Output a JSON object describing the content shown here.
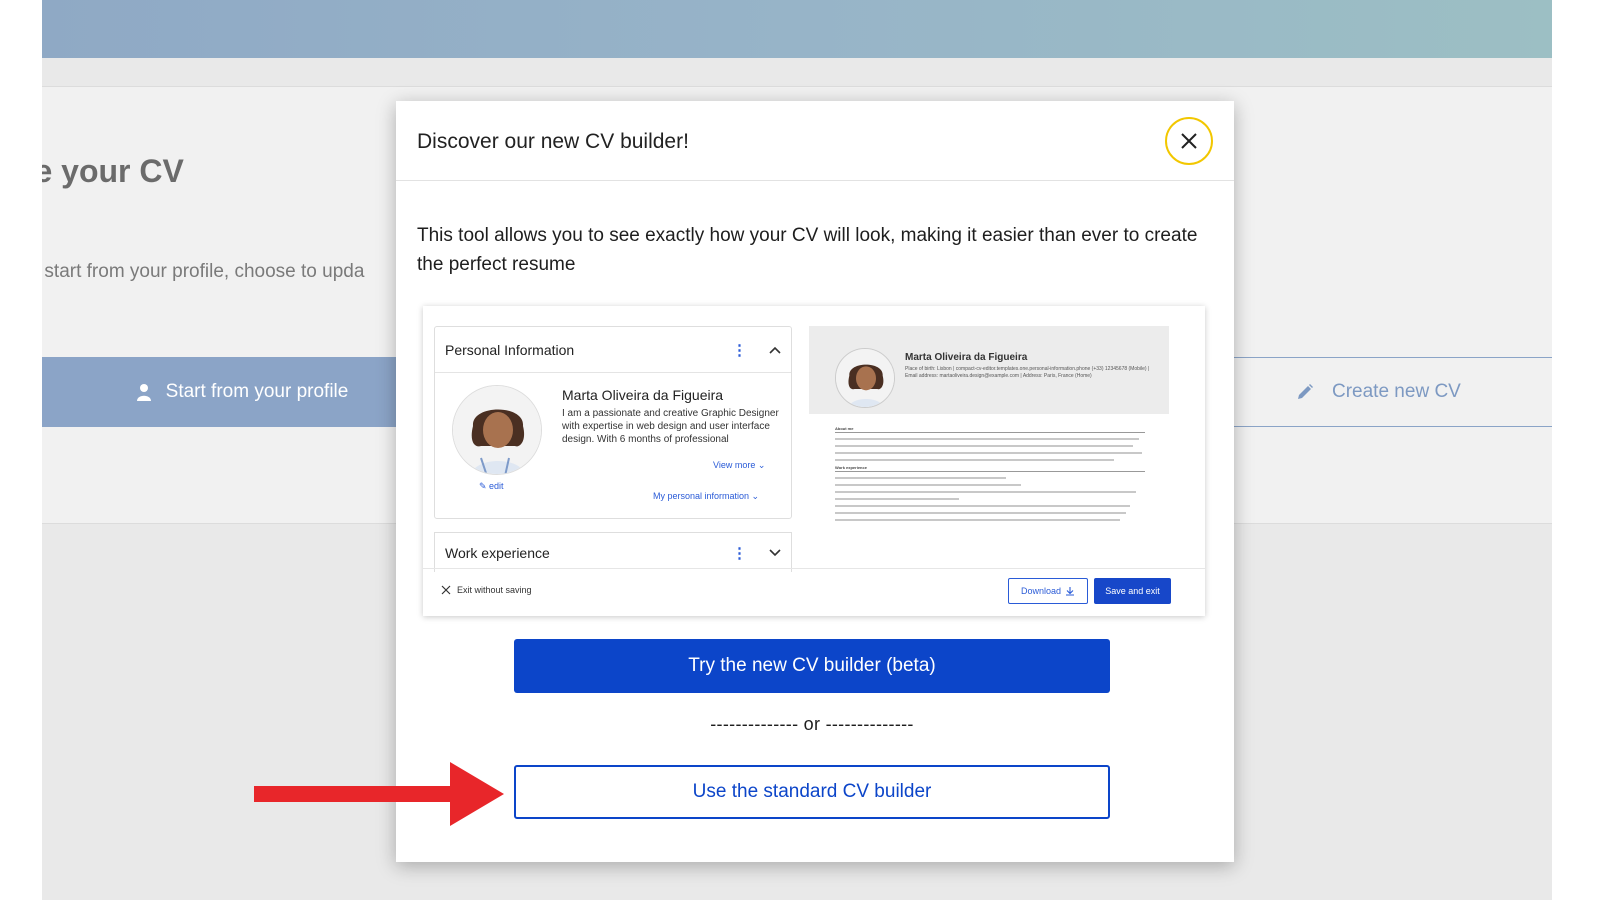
{
  "background_page": {
    "title": "ate your CV",
    "subtitle": "an start from your profile, choose to upda",
    "option_profile_label": "Start from your profile",
    "option_new_label": "Create new CV"
  },
  "modal": {
    "title": "Discover our new CV builder!",
    "description": "This tool allows you to see exactly how your CV will look, making it easier than ever to create the perfect resume",
    "primary_button": "Try the new CV builder (beta)",
    "separator": "-------------- or --------------",
    "secondary_button": "Use the standard CV builder"
  },
  "preview": {
    "personal_info_heading": "Personal Information",
    "person_name": "Marta Oliveira da Figueira",
    "bio": "I am a passionate and creative Graphic Designer with expertise in web design and user interface design. With 6 months of professional",
    "view_more": "View more",
    "edit": "edit",
    "my_personal_information": "My personal information",
    "work_experience_heading": "Work experience",
    "cv_name": "Marta Oliveira da Figueira",
    "cv_meta": "Place of birth: Lisbon | compact-cv-editor.templates.one.personal-information.phone (+33) 12345678 (Mobile) | Email address: martaoliveira.design@example.com | Address: Paris, France (Home)",
    "cv_section_about": "About me",
    "cv_section_work": "Work experience",
    "exit_without_saving": "Exit without saving",
    "download": "Download",
    "save_and_exit": "Save and exit"
  },
  "colors": {
    "primary_blue": "#0c45c9",
    "close_ring": "#f2c700",
    "annotation_arrow": "#e8262a"
  }
}
